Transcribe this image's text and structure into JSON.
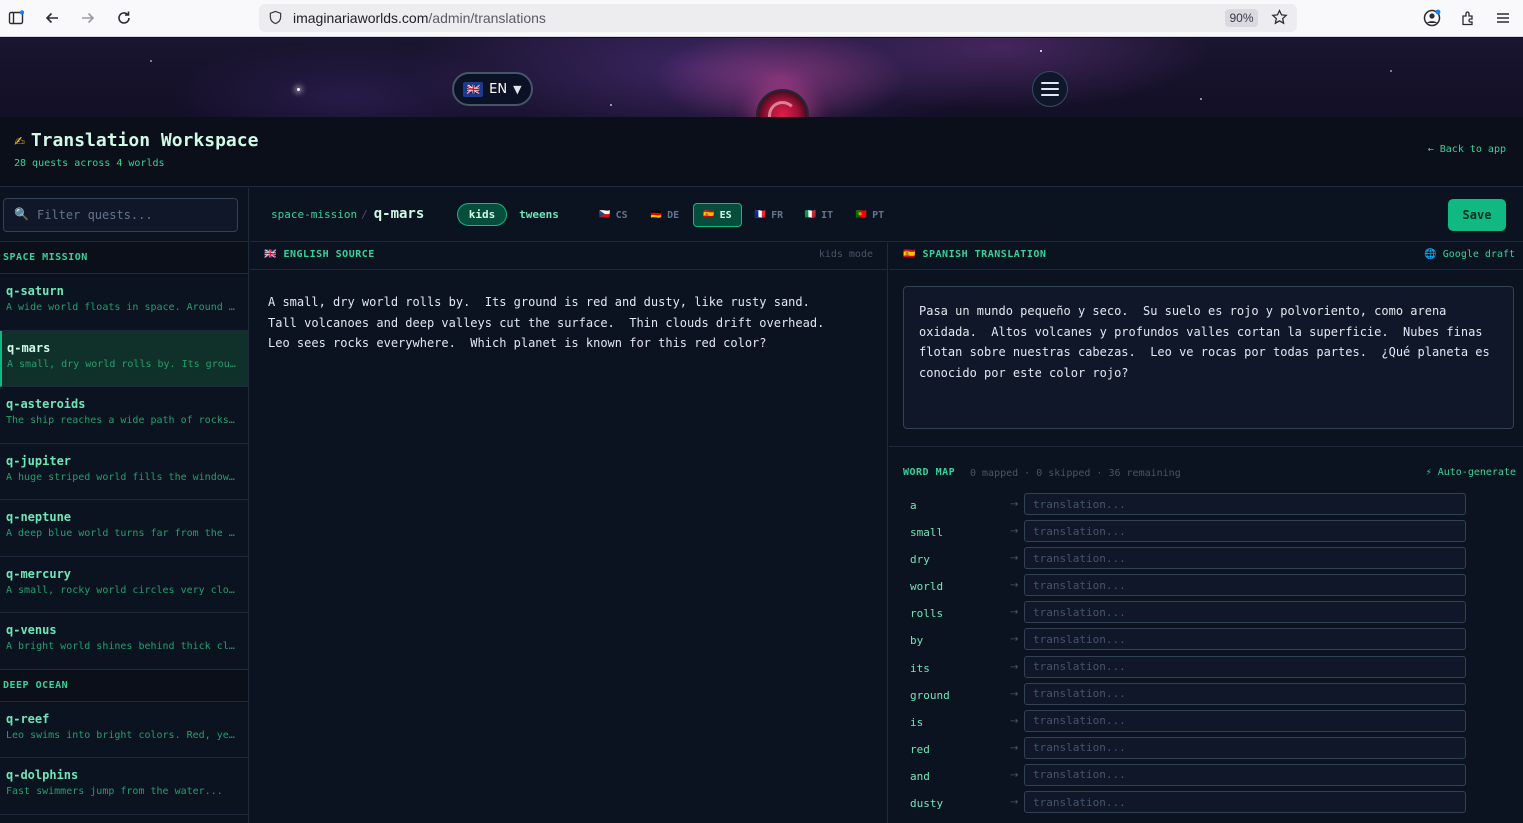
{
  "browser": {
    "url_host": "imaginariaworlds.com",
    "url_path": "/admin/translations",
    "zoom": "90%"
  },
  "banner": {
    "language": "EN",
    "language_flag": "🇬🇧"
  },
  "header": {
    "title": "Translation Workspace",
    "title_icon": "✍",
    "subtitle": "28 quests across 4 worlds",
    "back_link": "← Back to app"
  },
  "sidebar": {
    "filter_placeholder": "Filter quests...",
    "groups": [
      {
        "name": "SPACE MISSION",
        "quests": [
          {
            "id": "q-saturn",
            "preview": "A wide world floats in space. Around it..."
          },
          {
            "id": "q-mars",
            "preview": "A small, dry world rolls by. Its ground..."
          },
          {
            "id": "q-asteroids",
            "preview": "The ship reaches a wide path of rocks..."
          },
          {
            "id": "q-jupiter",
            "preview": "A huge striped world fills the window..."
          },
          {
            "id": "q-neptune",
            "preview": "A deep blue world turns far from the sun..."
          },
          {
            "id": "q-mercury",
            "preview": "A small, rocky world circles very close..."
          },
          {
            "id": "q-venus",
            "preview": "A bright world shines behind thick clouds..."
          }
        ]
      },
      {
        "name": "DEEP OCEAN",
        "quests": [
          {
            "id": "q-reef",
            "preview": "Leo swims into bright colors. Red, yellow..."
          },
          {
            "id": "q-dolphins",
            "preview": "Fast swimmers jump from the water..."
          }
        ]
      }
    ]
  },
  "toolbar": {
    "world": "space-mission",
    "separator": "/",
    "quest": "q-mars",
    "modes": [
      "kids",
      "tweens"
    ],
    "active_mode": "kids",
    "languages": [
      {
        "flag": "🇨🇿",
        "code": "CS"
      },
      {
        "flag": "🇩🇪",
        "code": "DE"
      },
      {
        "flag": "🇪🇸",
        "code": "ES"
      },
      {
        "flag": "🇫🇷",
        "code": "FR"
      },
      {
        "flag": "🇮🇹",
        "code": "IT"
      },
      {
        "flag": "🇵🇹",
        "code": "PT"
      }
    ],
    "active_language": "ES",
    "save_label": "Save"
  },
  "source": {
    "flag": "🇬🇧",
    "label": "ENGLISH SOURCE",
    "mode": "kids mode",
    "text": "A small, dry world rolls by.  Its ground is red and dusty, like rusty sand.\nTall volcanoes and deep valleys cut the surface.  Thin clouds drift overhead.\nLeo sees rocks everywhere.  Which planet is known for this red color?"
  },
  "translation": {
    "flag": "🇪🇸",
    "label": "SPANISH TRANSLATION",
    "draft_label": "🌐 Google draft",
    "text": "Pasa un mundo pequeño y seco.  Su suelo es rojo y polvoriento, como arena oxidada.  Altos volcanes y profundos valles cortan la superficie.  Nubes finas flotan sobre nuestras cabezas.  Leo ve rocas por todas partes.  ¿Qué planeta es conocido por este color rojo?"
  },
  "word_map": {
    "title": "WORD MAP",
    "stats": "0 mapped · 0 skipped · 36 remaining",
    "auto_label": "⚡ Auto-generate",
    "arrow": "→",
    "placeholder": "translation...",
    "words": [
      "a",
      "small",
      "dry",
      "world",
      "rolls",
      "by",
      "its",
      "ground",
      "is",
      "red",
      "and",
      "dusty"
    ]
  }
}
